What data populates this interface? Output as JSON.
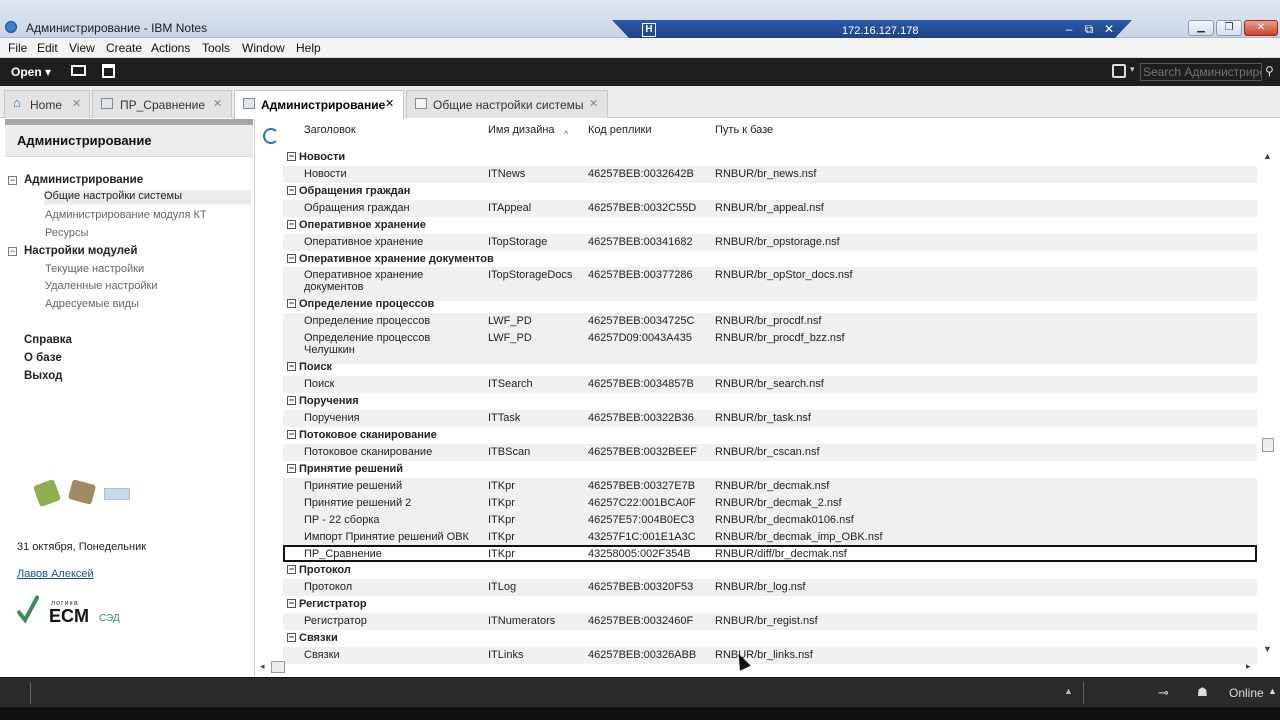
{
  "window": {
    "title": "Администрирование - IBM Notes",
    "remote_ip": "172.16.127.178",
    "remote_controls": [
      "‒",
      "⧉",
      "✕"
    ]
  },
  "menu": [
    "File",
    "Edit",
    "View",
    "Create",
    "Actions",
    "Tools",
    "Window",
    "Help"
  ],
  "toolbar": {
    "open_label": "Open",
    "search_placeholder": "Search Администрирование"
  },
  "tabs": [
    {
      "label": "Home",
      "active": false
    },
    {
      "label": "ПР_Сравнение",
      "active": false
    },
    {
      "label": "Администрирование",
      "active": true
    },
    {
      "label": "Общие настройки системы",
      "active": false
    }
  ],
  "sidebar": {
    "heading": "Администрирование",
    "groups": [
      {
        "label": "Администрирование",
        "items": [
          "Общие настройки системы",
          "Администрирование модуля КТ",
          "Ресурсы"
        ]
      },
      {
        "label": "Настройки модулей",
        "items": [
          "Текущие настройки",
          "Удаленные настройки",
          "Адресуемые виды"
        ]
      }
    ],
    "links": [
      "Справка",
      "О базе",
      "Выход"
    ],
    "date": "31 октября, Понедельник",
    "user": "Лавов Алексей",
    "brand": {
      "small": "логика",
      "big": "ECM",
      "sed": "СЭД"
    }
  },
  "view": {
    "columns": [
      "Заголовок",
      "Имя дизайна",
      "Код реплики",
      "Путь к базе"
    ],
    "groups": [
      {
        "name": "Новости",
        "rows": [
          [
            "Новости",
            "ITNews",
            "46257BEB:0032642B",
            "RNBUR/br_news.nsf"
          ]
        ]
      },
      {
        "name": "Обращения граждан",
        "rows": [
          [
            "Обращения граждан",
            "ITAppeal",
            "46257BEB:0032C55D",
            "RNBUR/br_appeal.nsf"
          ]
        ]
      },
      {
        "name": "Оперативное хранение",
        "rows": [
          [
            "Оперативное хранение",
            "ITopStorage",
            "46257BEB:00341682",
            "RNBUR/br_opstorage.nsf"
          ]
        ]
      },
      {
        "name": "Оперативное хранение документов",
        "rows": [
          [
            "Оперативное хранение документов",
            "ITopStorageDocs",
            "46257BEB:00377286",
            "RNBUR/br_opStor_docs.nsf"
          ]
        ]
      },
      {
        "name": "Определение процессов",
        "rows": [
          [
            "Определение процессов",
            "LWF_PD",
            "46257BEB:0034725C",
            "RNBUR/br_procdf.nsf"
          ],
          [
            "Определение процессов Челушкин",
            "LWF_PD",
            "46257D09:0043A435",
            "RNBUR/br_procdf_bzz.nsf"
          ]
        ]
      },
      {
        "name": "Поиск",
        "rows": [
          [
            "Поиск",
            "ITSearch",
            "46257BEB:0034857B",
            "RNBUR/br_search.nsf"
          ]
        ]
      },
      {
        "name": "Поручения",
        "rows": [
          [
            "Поручения",
            "ITTask",
            "46257BEB:00322B36",
            "RNBUR/br_task.nsf"
          ]
        ]
      },
      {
        "name": "Потоковое сканирование",
        "rows": [
          [
            "Потоковое сканирование",
            "ITBScan",
            "46257BEB:0032BEEF",
            "RNBUR/br_cscan.nsf"
          ]
        ]
      },
      {
        "name": "Принятие решений",
        "rows": [
          [
            "Принятие решений",
            "ITKpr",
            "46257BEB:00327E7B",
            "RNBUR/br_decmak.nsf"
          ],
          [
            "Принятие решений 2",
            "ITKpr",
            "46257C22:001BCA0F",
            "RNBUR/br_decmak_2.nsf"
          ],
          [
            "ПР - 22 сборка",
            "ITKpr",
            "46257E57:004B0EC3",
            "RNBUR/br_decmak0106.nsf"
          ],
          [
            "Импорт Принятие решений ОВК",
            "ITKpr",
            "43257F1C:001E1A3C",
            "RNBUR/br_decmak_imp_OBK.nsf"
          ],
          [
            "ПР_Сравнение",
            "ITKpr",
            "43258005:002F354B",
            "RNBUR/diff/br_decmak.nsf"
          ]
        ]
      },
      {
        "name": "Протокол",
        "rows": [
          [
            "Протокол",
            "ITLog",
            "46257BEB:00320F53",
            "RNBUR/br_log.nsf"
          ]
        ]
      },
      {
        "name": "Регистратор",
        "rows": [
          [
            "Регистратор",
            "ITNumerators",
            "46257BEB:0032460F",
            "RNBUR/br_regist.nsf"
          ]
        ]
      },
      {
        "name": "Связки",
        "rows": [
          [
            "Связки",
            "ITLinks",
            "46257BEB:00326ABB",
            "RNBUR/br_links.nsf"
          ]
        ]
      }
    ],
    "selected_title": "ПР_Сравнение"
  },
  "statusbar": {
    "online_label": "Online"
  },
  "colors": {
    "toolbar_bg": "#1e1e1e",
    "selected_nav": "#ececec",
    "link": "#1a4f9c",
    "rdp_bar": "#2a5aa8"
  }
}
